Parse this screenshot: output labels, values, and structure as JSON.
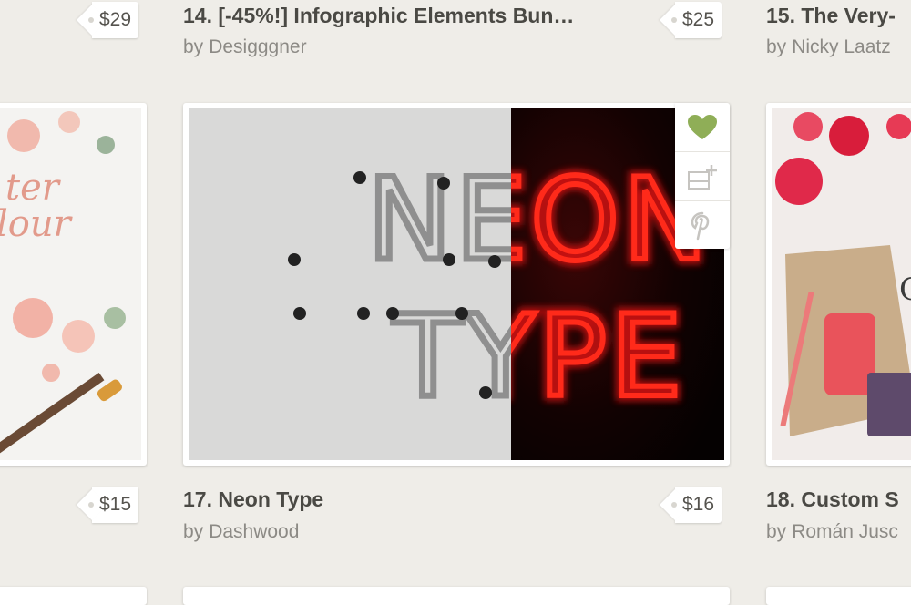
{
  "products": [
    {
      "title": "14. [-45%!] Infographic Elements Bun…",
      "author": "Desigggner",
      "price": "$29"
    },
    {
      "title": "15. The Very-",
      "author": "Nicky Laatz",
      "price": "$25"
    },
    {
      "title": "17. Neon Type",
      "author": "Dashwood",
      "price": "$15"
    },
    {
      "title": "18. Custom S",
      "author": "Román Jusc",
      "price": "$16"
    }
  ],
  "by_label": "by",
  "neon_image": {
    "line1": "NEON",
    "line2": "TYPE"
  },
  "colors": {
    "heart": "#8fae57",
    "neon": "#ff1414",
    "background": "#efede8"
  },
  "actions": [
    "heart-icon",
    "add-to-collection-icon",
    "pinterest-icon"
  ]
}
